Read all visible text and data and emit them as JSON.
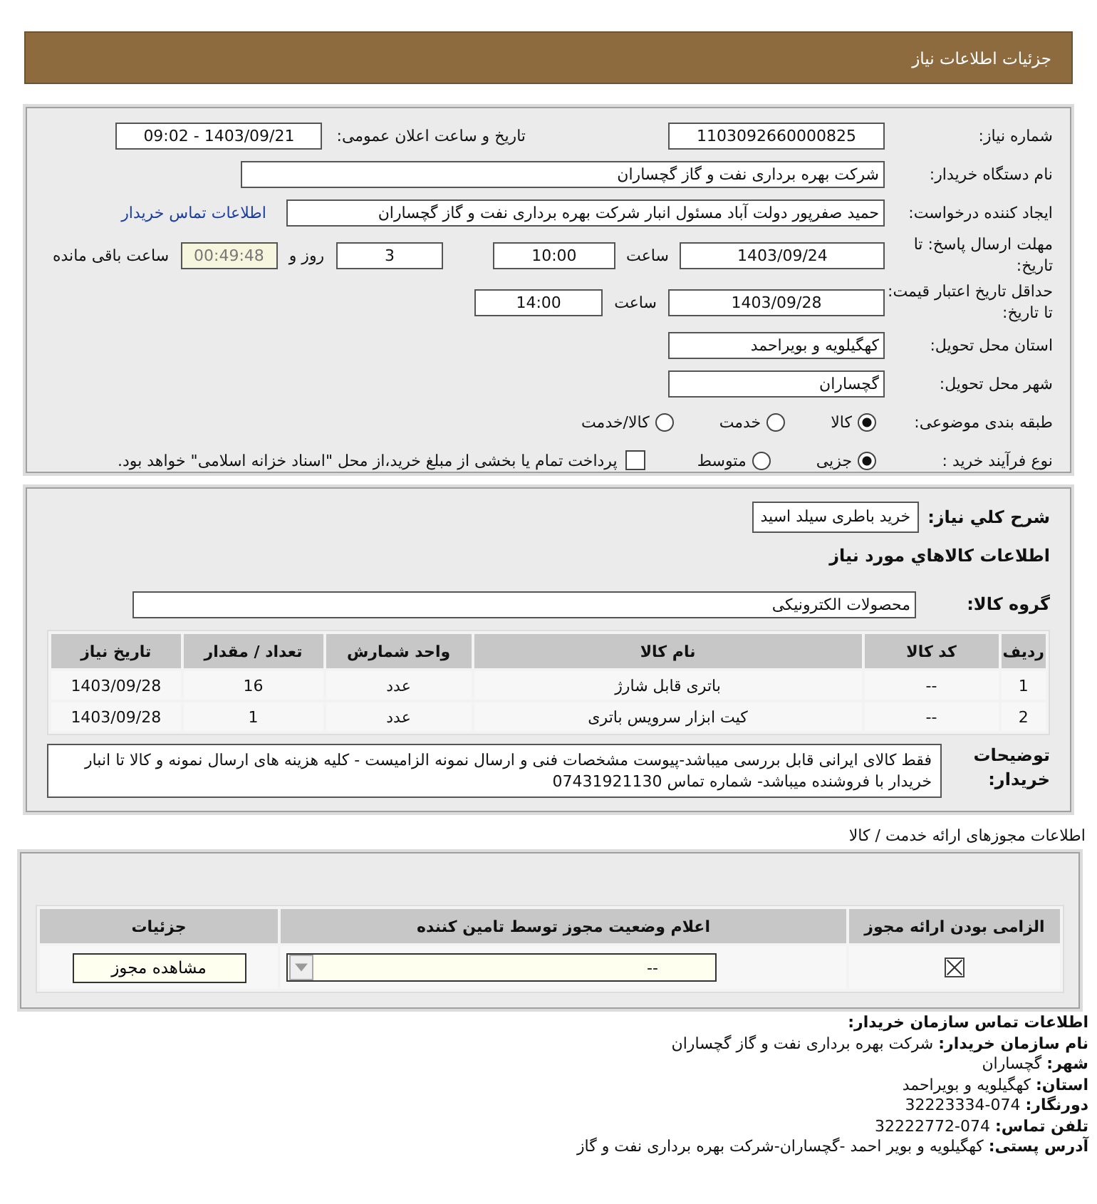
{
  "header": {
    "title": "جزئیات اطلاعات نیاز"
  },
  "need_info": {
    "need_number": {
      "label": "شماره نیاز:",
      "value": "1103092660000825"
    },
    "announce": {
      "label": "تاریخ و ساعت اعلان عمومی:",
      "value": "1403/09/21 - 09:02"
    },
    "buyer_org": {
      "label": "نام دستگاه خریدار:",
      "value": "شرکت بهره برداری نفت و گاز گچساران"
    },
    "requester": {
      "label": "ایجاد کننده درخواست:",
      "value": "حمید  صفرپور دولت آباد مسئول انبار شرکت بهره برداری نفت و گاز گچساران",
      "link": "اطلاعات تماس خریدار"
    },
    "reply_deadline": {
      "label": "مهلت ارسال پاسخ: تا تاریخ:",
      "date": "1403/09/24",
      "time_label": "ساعت",
      "time": "10:00",
      "days": "3",
      "days_label": "روز و",
      "remaining": "00:49:48",
      "remaining_label": "ساعت باقی مانده"
    },
    "price_validity": {
      "label": "حداقل تاریخ اعتبار قیمت: تا تاریخ:",
      "date": "1403/09/28",
      "time_label": "ساعت",
      "time": "14:00"
    },
    "province": {
      "label": "استان محل تحویل:",
      "value": "کهگیلویه و بویراحمد"
    },
    "city": {
      "label": "شهر محل تحویل:",
      "value": "گچساران"
    },
    "category": {
      "label": "طبقه بندی موضوعی:",
      "options": [
        {
          "label": "کالا",
          "selected": true
        },
        {
          "label": "خدمت",
          "selected": false
        },
        {
          "label": "کالا/خدمت",
          "selected": false
        }
      ]
    },
    "purchase_type": {
      "label": "نوع فرآیند خرید :",
      "options": [
        {
          "label": "جزیی",
          "selected": true
        },
        {
          "label": "متوسط",
          "selected": false
        }
      ],
      "payment": {
        "label": "پرداخت تمام یا بخشی از مبلغ خرید،از محل \"اسناد خزانه اسلامی\" خواهد بود.",
        "checked": false
      }
    }
  },
  "goods": {
    "description": {
      "label": "شرح کلي نياز:",
      "value": "خرید باطری سیلد اسید"
    },
    "heading": "اطلاعات کالاهاي مورد نياز",
    "group": {
      "label": "گروه کالا:",
      "value": "محصولات الکترونیکی"
    },
    "table": {
      "columns": [
        "ردیف",
        "کد کالا",
        "نام کالا",
        "واحد شمارش",
        "تعداد / مقدار",
        "تاریخ نیاز"
      ],
      "rows": [
        [
          "1",
          "--",
          "باتری قابل شارژ",
          "عدد",
          "16",
          "1403/09/28"
        ],
        [
          "2",
          "--",
          "کیت ابزار سرویس باتری",
          "عدد",
          "1",
          "1403/09/28"
        ]
      ]
    },
    "notes": {
      "label": "توضیحات خریدار:",
      "value": "فقط کالای ایرانی قابل بررسی میباشد-پیوست مشخصات فنی و ارسال نمونه الزامیست - کلیه هزینه های ارسال نمونه و کالا تا انبار خریدار با فروشنده میباشد- شماره تماس 07431921130"
    }
  },
  "permits": {
    "heading": "اطلاعات مجوزهای ارائه خدمت / کالا",
    "columns": [
      "الزامی بودن ارائه مجوز",
      "اعلام وضعیت مجوز توسط تامین کننده",
      "جزئیات"
    ],
    "rows": [
      {
        "required": true,
        "status": "--",
        "button": "مشاهده مجوز"
      }
    ]
  },
  "contact": {
    "heading": "اطلاعات تماس سازمان خریدار:",
    "lines": [
      "**نام سازمان خریدار:** شرکت بهره برداری نفت و گاز گچساران",
      "**شهر:** گچساران",
      "**استان:** کهگیلویه و بویراحمد",
      "**دورنگار:** 074-32223334",
      "**تلفن تماس:** 074-32222772",
      "**آدرس پستی:** کهگیلویه و بویر احمد -گچساران-شرکت بهره برداری نفت و گاز"
    ]
  }
}
